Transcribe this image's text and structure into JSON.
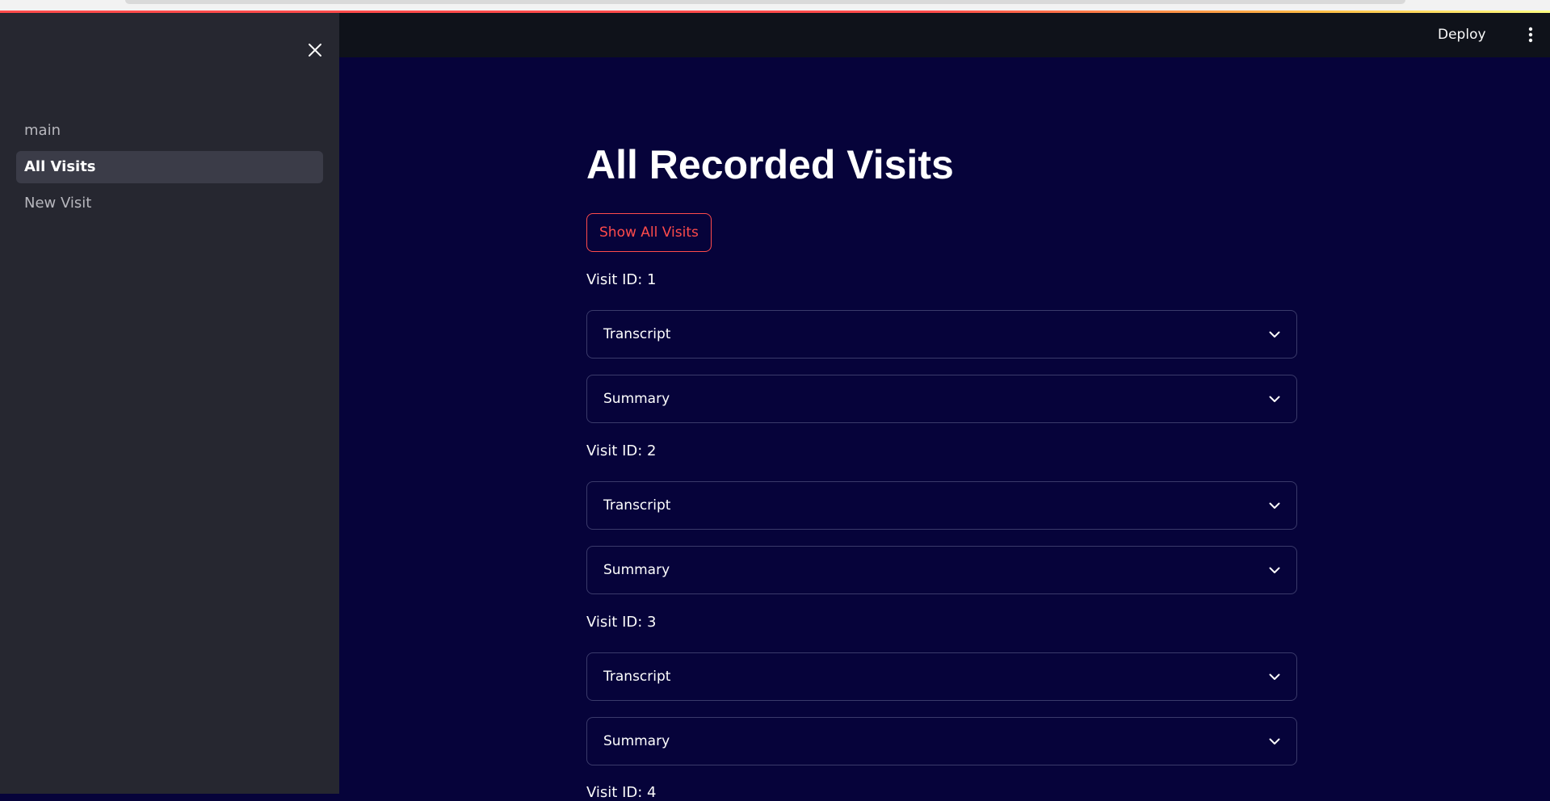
{
  "sidebar": {
    "items": [
      {
        "label": "main"
      },
      {
        "label": "All Visits"
      },
      {
        "label": "New Visit"
      }
    ]
  },
  "header": {
    "deploy_label": "Deploy"
  },
  "main": {
    "title": "All Recorded Visits",
    "show_button": "Show All Visits",
    "visits": [
      {
        "label": "Visit ID: 1",
        "transcript": "Transcript",
        "summary": "Summary"
      },
      {
        "label": "Visit ID: 2",
        "transcript": "Transcript",
        "summary": "Summary"
      },
      {
        "label": "Visit ID: 3",
        "transcript": "Transcript",
        "summary": "Summary"
      },
      {
        "label": "Visit ID: 4"
      }
    ]
  },
  "colors": {
    "background": "#06033a",
    "sidebar": "#262730",
    "header": "#0f121a",
    "accent": "#ff4b4b"
  },
  "icons": [
    "close-icon",
    "more-vert-icon",
    "chevron-down-icon"
  ]
}
